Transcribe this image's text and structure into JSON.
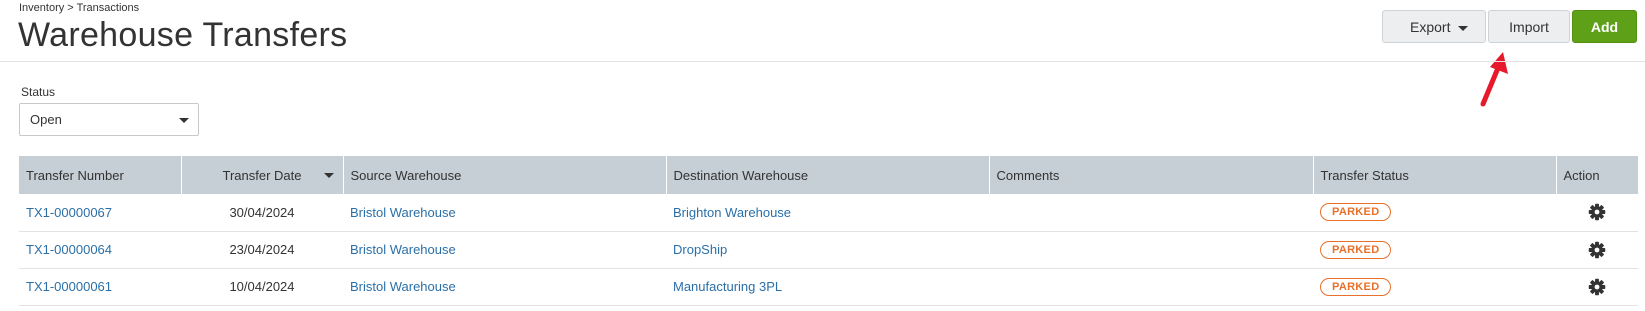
{
  "breadcrumb": "Inventory > Transactions",
  "page_title": "Warehouse Transfers",
  "toolbar": {
    "export_label": "Export",
    "import_label": "Import",
    "add_label": "Add"
  },
  "filter": {
    "status_label": "Status",
    "status_value": "Open"
  },
  "table": {
    "headers": {
      "transfer_number": "Transfer Number",
      "transfer_date": "Transfer Date",
      "source_warehouse": "Source Warehouse",
      "destination_warehouse": "Destination Warehouse",
      "comments": "Comments",
      "transfer_status": "Transfer Status",
      "action": "Action"
    },
    "rows": [
      {
        "transfer_number": "TX1-00000067",
        "transfer_date": "30/04/2024",
        "source_warehouse": "Bristol Warehouse",
        "destination_warehouse": "Brighton Warehouse",
        "comments": "",
        "transfer_status": "PARKED"
      },
      {
        "transfer_number": "TX1-00000064",
        "transfer_date": "23/04/2024",
        "source_warehouse": "Bristol Warehouse",
        "destination_warehouse": "DropShip",
        "comments": "",
        "transfer_status": "PARKED"
      },
      {
        "transfer_number": "TX1-00000061",
        "transfer_date": "10/04/2024",
        "source_warehouse": "Bristol Warehouse",
        "destination_warehouse": "Manufacturing 3PL",
        "comments": "",
        "transfer_status": "PARKED"
      }
    ]
  },
  "icons": {
    "action": "gear-icon",
    "annotation": "red-arrow-icon"
  },
  "colors": {
    "add_button": "#5fa019",
    "link": "#2a6fa8",
    "status_badge": "#e8702a",
    "header_bg": "#c6ced6",
    "arrow": "#e8192c"
  }
}
